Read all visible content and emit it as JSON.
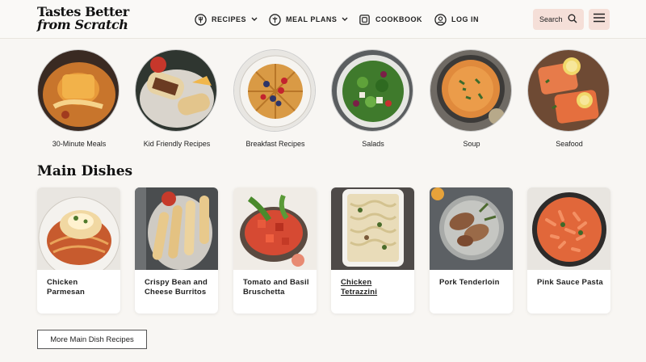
{
  "brand": {
    "line1": "Tastes Better",
    "line2": "from Scratch"
  },
  "nav": [
    {
      "label": "RECIPES",
      "icon": "fork-icon",
      "dropdown": true
    },
    {
      "label": "MEAL PLANS",
      "icon": "clipboard-icon",
      "dropdown": true
    },
    {
      "label": "COOKBOOK",
      "icon": "book-icon",
      "dropdown": false
    },
    {
      "label": "LOG IN",
      "icon": "user-icon",
      "dropdown": false
    }
  ],
  "search": {
    "label": "Search"
  },
  "categories": [
    {
      "label": "30-Minute Meals"
    },
    {
      "label": "Kid Friendly Recipes"
    },
    {
      "label": "Breakfast Recipes"
    },
    {
      "label": "Salads"
    },
    {
      "label": "Soup"
    },
    {
      "label": "Seafood"
    }
  ],
  "main_dishes": {
    "title": "Main Dishes",
    "cards": [
      {
        "title": "Chicken Parmesan"
      },
      {
        "title": "Crispy Bean and Cheese Burritos"
      },
      {
        "title": "Tomato and Basil Bruschetta"
      },
      {
        "title": "Chicken Tetrazzini"
      },
      {
        "title": "Pork Tenderloin"
      },
      {
        "title": "Pink Sauce Pasta"
      }
    ],
    "more_label": "More Main Dish Recipes"
  },
  "colors": {
    "accent_bg": "#f5dfd8",
    "page_bg": "#f8f6f3"
  }
}
